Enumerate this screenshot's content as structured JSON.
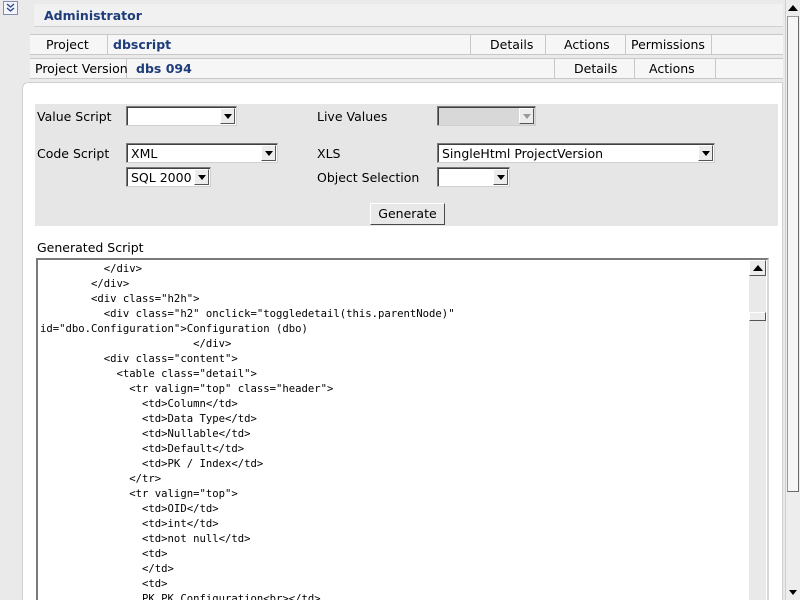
{
  "header": {
    "title": "Administrator"
  },
  "project_row": {
    "label": "Project",
    "value": "dbscript",
    "actions": [
      "Details",
      "Actions",
      "Permissions"
    ]
  },
  "version_row": {
    "label": "Project Version",
    "value": "dbs 094",
    "actions": [
      "Details",
      "Actions"
    ]
  },
  "form": {
    "value_script": {
      "label": "Value Script",
      "value": ""
    },
    "live_values": {
      "label": "Live Values",
      "value": ""
    },
    "code_script": {
      "label": "Code Script",
      "value": "XML"
    },
    "xls": {
      "label": "XLS",
      "value": "SingleHtml ProjectVersion"
    },
    "dialect": {
      "value": "SQL 2000"
    },
    "object_selection": {
      "label": "Object Selection",
      "value": ""
    },
    "generate_label": "Generate"
  },
  "generated": {
    "label": "Generated Script",
    "text": "          </div>\n        </div>\n        <div class=\"h2h\">\n          <div class=\"h2\" onclick=\"toggledetail(this.parentNode)\"\nid=\"dbo.Configuration\">Configuration (dbo)\n                        </div>\n          <div class=\"content\">\n            <table class=\"detail\">\n              <tr valign=\"top\" class=\"header\">\n                <td>Column</td>\n                <td>Data Type</td>\n                <td>Nullable</td>\n                <td>Default</td>\n                <td>PK / Index</td>\n              </tr>\n              <tr valign=\"top\">\n                <td>OID</td>\n                <td>int</td>\n                <td>not null</td>\n                <td>\n                </td>\n                <td>\n                PK PK_Configuration<br></td>"
  },
  "icons": {
    "collapse": "double-chevron-down-icon",
    "scroll_up": "triangle-up-icon",
    "scroll_down": "triangle-down-icon"
  },
  "colors": {
    "accent": "#1e3c7a",
    "panel": "#e6e6e6",
    "background": "#eaeaea"
  }
}
